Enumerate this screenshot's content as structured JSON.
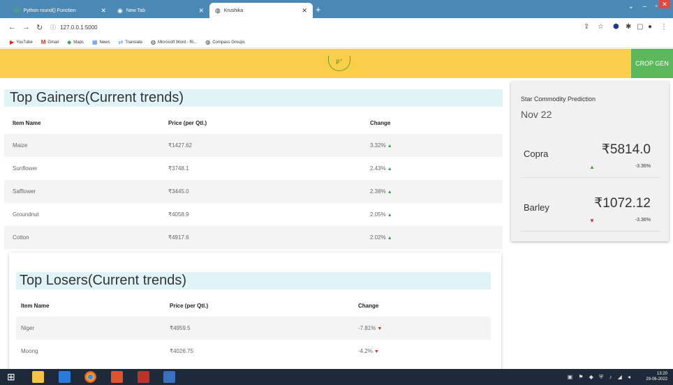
{
  "browser": {
    "tabs": [
      {
        "label": "Python round() Function",
        "icon": "w3schools-icon"
      },
      {
        "label": "New Tab",
        "icon": "chrome-icon"
      },
      {
        "label": "Krushika",
        "icon": "globe-icon"
      }
    ],
    "url": "127.0.0.1:5000",
    "bookmarks": [
      "YouTube",
      "Gmail",
      "Maps",
      "News",
      "Translate",
      "Microsoft Word - Ri...",
      "Compass Groups"
    ]
  },
  "header": {
    "logo_text": "ꝑ⁺",
    "cta_label": "CROP GEN",
    "bg_color": "#f9cf4a",
    "cta_color": "#5cb85c"
  },
  "gainers": {
    "title": "Top Gainers(Current trends)",
    "columns": [
      "Item Name",
      "Price (per Qtl.)",
      "Change"
    ],
    "rows": [
      {
        "name": "Maize",
        "price": "₹1427.62",
        "change": "3.32%"
      },
      {
        "name": "Sunflower",
        "price": "₹3748.1",
        "change": "2.43%"
      },
      {
        "name": "Safflower",
        "price": "₹3445.0",
        "change": "2.38%"
      },
      {
        "name": "Groundnut",
        "price": "₹4058.9",
        "change": "2.05%"
      },
      {
        "name": "Cotton",
        "price": "₹4917.6",
        "change": "2.02%"
      }
    ]
  },
  "losers": {
    "title": "Top Losers(Current trends)",
    "columns": [
      "Item Name",
      "Price (per Qtl.)",
      "Change"
    ],
    "rows": [
      {
        "name": "Niger",
        "price": "₹4959.5",
        "change": "-7.81%"
      },
      {
        "name": "Moong",
        "price": "₹4026.75",
        "change": "-4.2%"
      }
    ]
  },
  "star": {
    "title": "Star Commodity Prediction",
    "month": "Nov 22",
    "items": [
      {
        "name": "Copra",
        "price": "₹5814.0",
        "change": "-3.36%",
        "trend": "up"
      },
      {
        "name": "Barley",
        "price": "₹1072.12",
        "change": "-3.36%",
        "trend": "down"
      }
    ]
  },
  "taskbar": {
    "time": "13:20",
    "date": "29-06-2022"
  }
}
